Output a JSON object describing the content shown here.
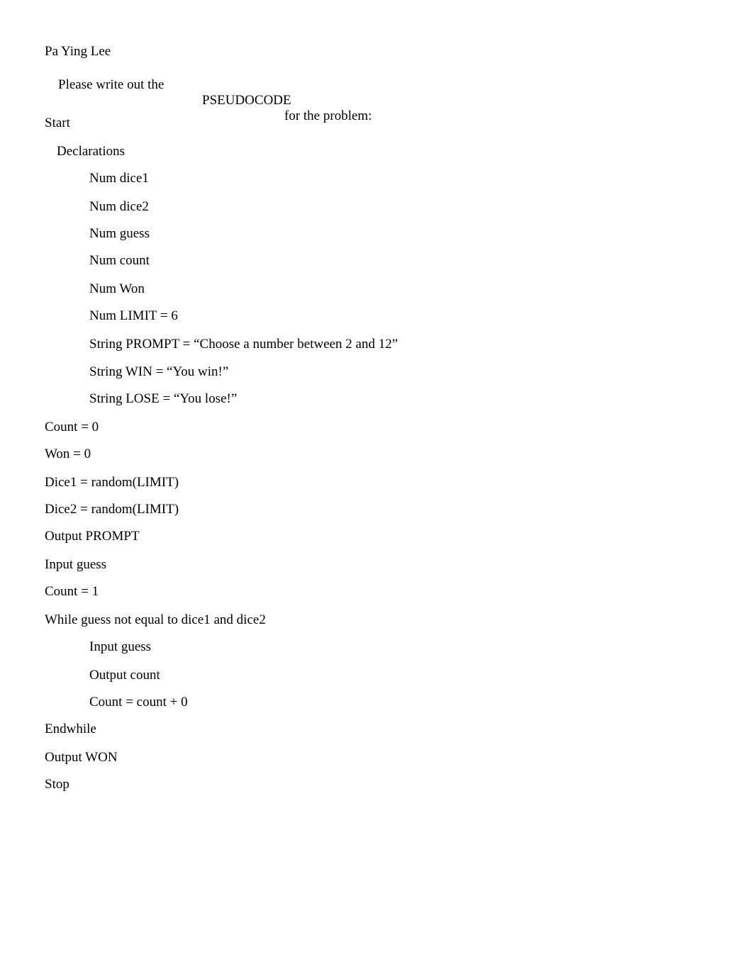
{
  "header": {
    "author": "Pa Ying Lee",
    "instruction_prefix": "Please write out the",
    "instruction_keyword": "PSEUDOCODE",
    "instruction_suffix": "for the problem:"
  },
  "pseudocode": {
    "lines": [
      {
        "text": "Start",
        "indent": 0
      },
      {
        "text": "Declarations",
        "indent": 1
      },
      {
        "text": "Num dice1",
        "indent": 2
      },
      {
        "text": "Num dice2",
        "indent": 2
      },
      {
        "text": "Num guess",
        "indent": 2
      },
      {
        "text": "Num count",
        "indent": 2
      },
      {
        "text": "Num Won",
        "indent": 2
      },
      {
        "text": "Num LIMIT = 6",
        "indent": 2
      },
      {
        "text": "String PROMPT = “Choose a number between 2 and 12”",
        "indent": 2
      },
      {
        "text": "String WIN = “You win!”",
        "indent": 2
      },
      {
        "text": "String LOSE = “You lose!”",
        "indent": 2
      },
      {
        "text": "Count = 0",
        "indent": 0
      },
      {
        "text": "Won = 0",
        "indent": 0
      },
      {
        "text": "Dice1 = random(LIMIT)",
        "indent": 0
      },
      {
        "text": "Dice2 = random(LIMIT)",
        "indent": 0
      },
      {
        "text": "Output PROMPT",
        "indent": 0
      },
      {
        "text": "Input guess",
        "indent": 0
      },
      {
        "text": "Count = 1",
        "indent": 0
      },
      {
        "text": "While guess not equal to dice1 and dice2",
        "indent": 0
      },
      {
        "text": "Input guess",
        "indent": 2
      },
      {
        "text": "Output count",
        "indent": 2
      },
      {
        "text": "Count = count + 0",
        "indent": 2
      },
      {
        "text": "Endwhile",
        "indent": 0
      },
      {
        "text": "Output WON",
        "indent": 0
      },
      {
        "text": "Stop",
        "indent": 0
      }
    ]
  }
}
